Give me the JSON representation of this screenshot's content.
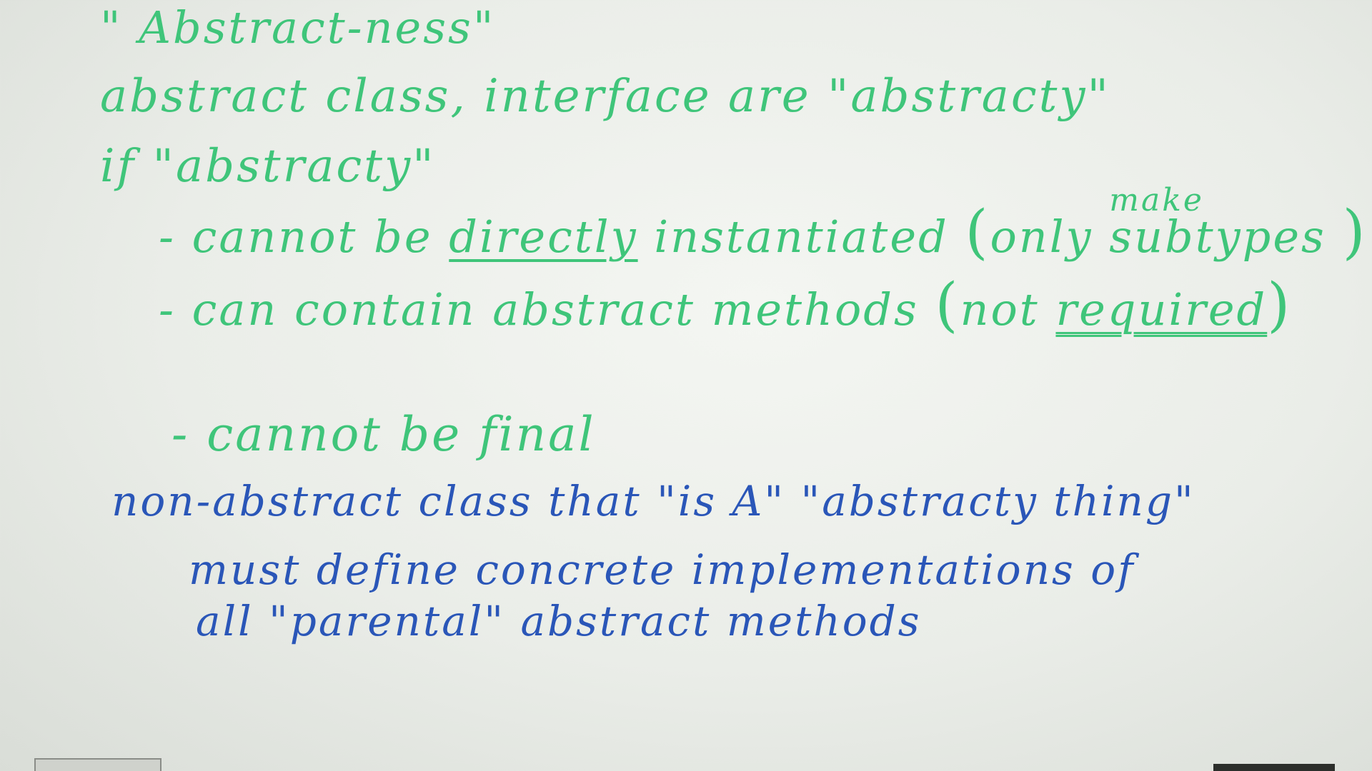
{
  "board": {
    "title": "\" Abstract-ness\"",
    "line1": "abstract class, interface are \"abstracty\"",
    "line2": "if \"abstracty\"",
    "bullet1": {
      "prefix": "- cannot be",
      "underlined": "directly",
      "middle": "instantiated",
      "paren_open": "(",
      "paren_text": "only",
      "stack_top": "make",
      "stack_bottom": "subtypes",
      "paren_close": ")"
    },
    "bullet2": {
      "prefix": "- can contain abstract methods",
      "paren_open": "(",
      "paren_text": "not",
      "underlined": "required",
      "paren_close": ")"
    },
    "bullet3": "- cannot be final",
    "rule1": "non-abstract class that \"is A\" \"abstracty thing\"",
    "rule2": "must define concrete implementations of",
    "rule3": "all \"parental\" abstract methods",
    "colors": {
      "green_marker": "#3fc57a",
      "blue_marker": "#2a56b8",
      "board": "#eef1ec"
    }
  }
}
